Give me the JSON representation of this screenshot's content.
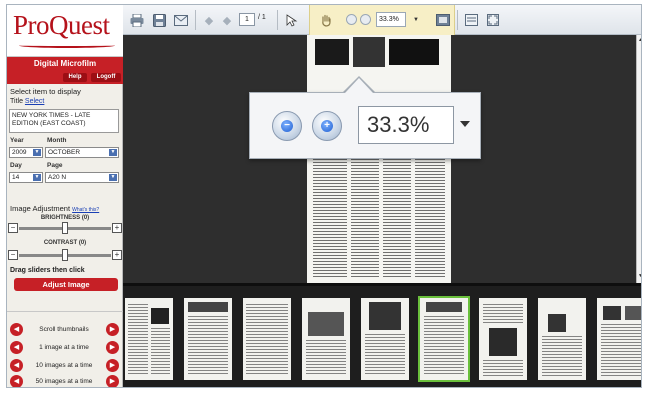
{
  "sidebar": {
    "logo": "ProQuest",
    "digital_microfilm": "Digital Microfilm",
    "help_label": "Help",
    "logoff_label": "Logoff",
    "select_item": "Select item to display",
    "title_label": "Title",
    "select_link": "Select",
    "title_value": "NEW YORK TIMES - LATE EDITION (EAST COAST)",
    "year_label": "Year",
    "month_label": "Month",
    "year_value": "2009",
    "month_value": "OCTOBER",
    "day_label": "Day",
    "page_label": "Page",
    "day_value": "14",
    "page_value": "A20 N",
    "image_adjustment": "Image Adjustment",
    "whats_this": "What's this?",
    "brightness_label": "BRIGHTNESS (0)",
    "contrast_label": "CONTRAST (0)",
    "drag_sliders": "Drag sliders then click",
    "adjust_button": "Adjust Image",
    "brightness_value": 0,
    "contrast_value": 0,
    "nav": [
      {
        "label": "Scroll thumbnails"
      },
      {
        "label": "1 image at a time"
      },
      {
        "label": "10 images at a time"
      },
      {
        "label": "50 images at a time"
      }
    ]
  },
  "toolbar": {
    "page_current": "1",
    "page_total": "/ 1",
    "zoom_value": "33.3%",
    "icons": [
      "print-icon",
      "save-icon",
      "email-icon",
      "prev-page-icon",
      "next-page-icon",
      "select-tool-icon",
      "pan-hand-icon",
      "zoom-out-icon",
      "zoom-in-icon",
      "fit-page-icon",
      "fit-width-icon",
      "fullscreen-icon"
    ]
  },
  "callout": {
    "zoom_value": "33.3%"
  },
  "colors": {
    "brand_red": "#c62026",
    "viewer_bg": "#2e2e2e",
    "thumb_selected": "#6ac03c"
  }
}
